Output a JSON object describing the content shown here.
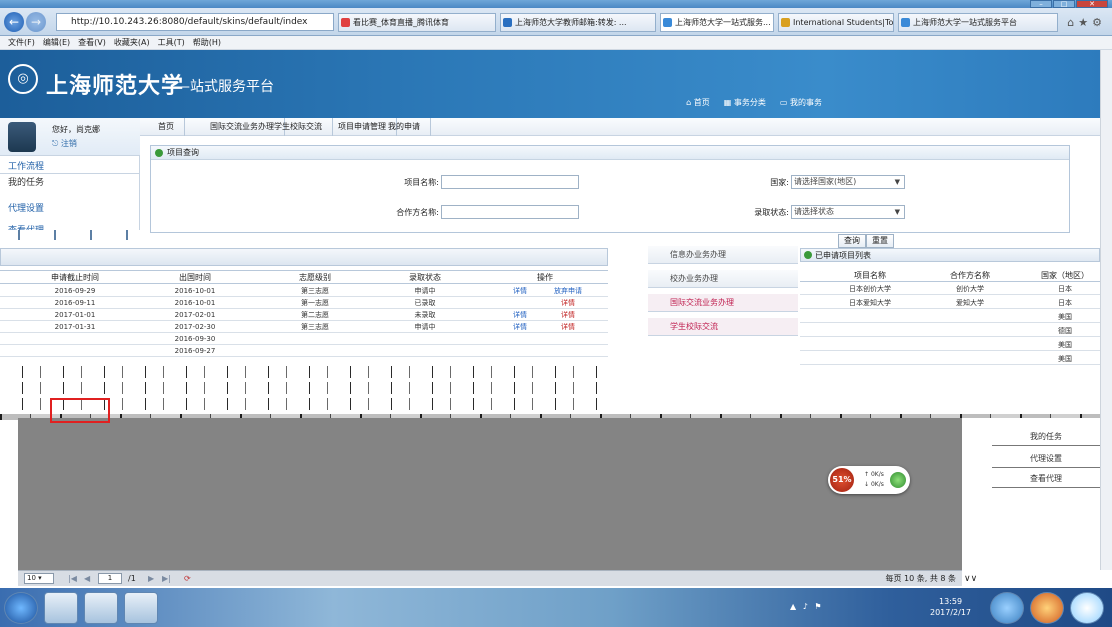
{
  "browser": {
    "url": "http://10.10.243.26:8080/default/skins/default/index",
    "tabs": [
      {
        "label": "看比赛_体育直播_腾讯体育",
        "color": "#e04040"
      },
      {
        "label": "上海师范大学教师邮箱:转发: ...",
        "color": "#2a6fc0"
      },
      {
        "label": "上海师范大学一站式服务...",
        "color": "#3a8ad8",
        "active": true
      },
      {
        "label": "International Students|Toky...",
        "color": "#d9a020"
      },
      {
        "label": "上海师范大学一站式服务平台",
        "color": "#3a8ad8"
      }
    ],
    "menu": [
      "文件(F)",
      "编辑(E)",
      "查看(V)",
      "收藏夹(A)",
      "工具(T)",
      "帮助(H)"
    ]
  },
  "header": {
    "brand": "上海师范大学",
    "subtitle": "—站式服务平台",
    "nav": [
      "首页",
      "事务分类",
      "我的事务"
    ]
  },
  "user": {
    "greeting": "您好，尚克娜",
    "logout": "注销"
  },
  "sidebar": {
    "section": "工作流程",
    "items": [
      "我的任务",
      "代理设置",
      "查看代理"
    ]
  },
  "breadcrumbs": [
    "首页",
    "国际交流业务办理",
    "学生校际交流",
    "项目申请管理",
    "我的申请"
  ],
  "query": {
    "title": "项目查询",
    "project_name_label": "项目名称:",
    "partner_label": "合作方名称:",
    "country_label": "国家:",
    "country_placeholder": "请选择国家(地区)",
    "status_label": "录取状态:",
    "status_placeholder": "请选择状态",
    "search_button": "查询",
    "reset_button": "重置"
  },
  "table": {
    "columns": [
      "申请截止时间",
      "出国时间",
      "志愿级别",
      "录取状态",
      "操作"
    ],
    "rows": [
      {
        "deadline": "2016-09-29",
        "depart": "2016-10-01",
        "level": "第三志愿",
        "status": "申请中",
        "op1": "详情",
        "op2": "放弃申请"
      },
      {
        "deadline": "2016-09-11",
        "depart": "2016-10-01",
        "level": "第一志愿",
        "status": "已录取",
        "op1": "",
        "op2": "详情"
      },
      {
        "deadline": "2017-01-01",
        "depart": "2017-02-01",
        "level": "第二志愿",
        "status": "未录取",
        "op1": "详情",
        "op2": "详情"
      },
      {
        "deadline": "2017-01-31",
        "depart": "2017-02-30",
        "level": "第三志愿",
        "status": "申请中",
        "op1": "详情",
        "op2": "详情"
      },
      {
        "deadline": "",
        "depart": "2016-09-30",
        "level": "",
        "status": "",
        "op1": "",
        "op2": ""
      },
      {
        "deadline": "",
        "depart": "2016-09-27",
        "level": "",
        "status": "",
        "op1": "",
        "op2": ""
      },
      {
        "deadline": "",
        "depart": "",
        "level": "",
        "status": "",
        "op1": "",
        "op2": ""
      }
    ]
  },
  "midmenu": [
    "信息办业务办理",
    "校办业务办理",
    "国际交流业务办理",
    "学生校际交流"
  ],
  "applied": {
    "title": "已申请项目列表",
    "columns": [
      "项目名称",
      "合作方名称",
      "国家（地区）"
    ],
    "rows": [
      [
        "日本创价大学",
        "创价大学",
        "日本"
      ],
      [
        "日本爱知大学",
        "爱知大学",
        "日本"
      ],
      [
        "",
        "",
        "美国"
      ],
      [
        "",
        "",
        "德国"
      ],
      [
        "",
        "",
        "美国"
      ],
      [
        "",
        "",
        "美国"
      ]
    ]
  },
  "rightpanel": [
    "我的任务",
    "代理设置",
    "查看代理"
  ],
  "pager": {
    "page_size": "10",
    "page": "1",
    "total_pages": "/1",
    "info": "每页 10 条, 共 8 条"
  },
  "speed": {
    "percent": "51%",
    "up": "0K/s",
    "down": "0K/s"
  },
  "clock": {
    "time": "13:59",
    "date": "2017/2/17"
  }
}
